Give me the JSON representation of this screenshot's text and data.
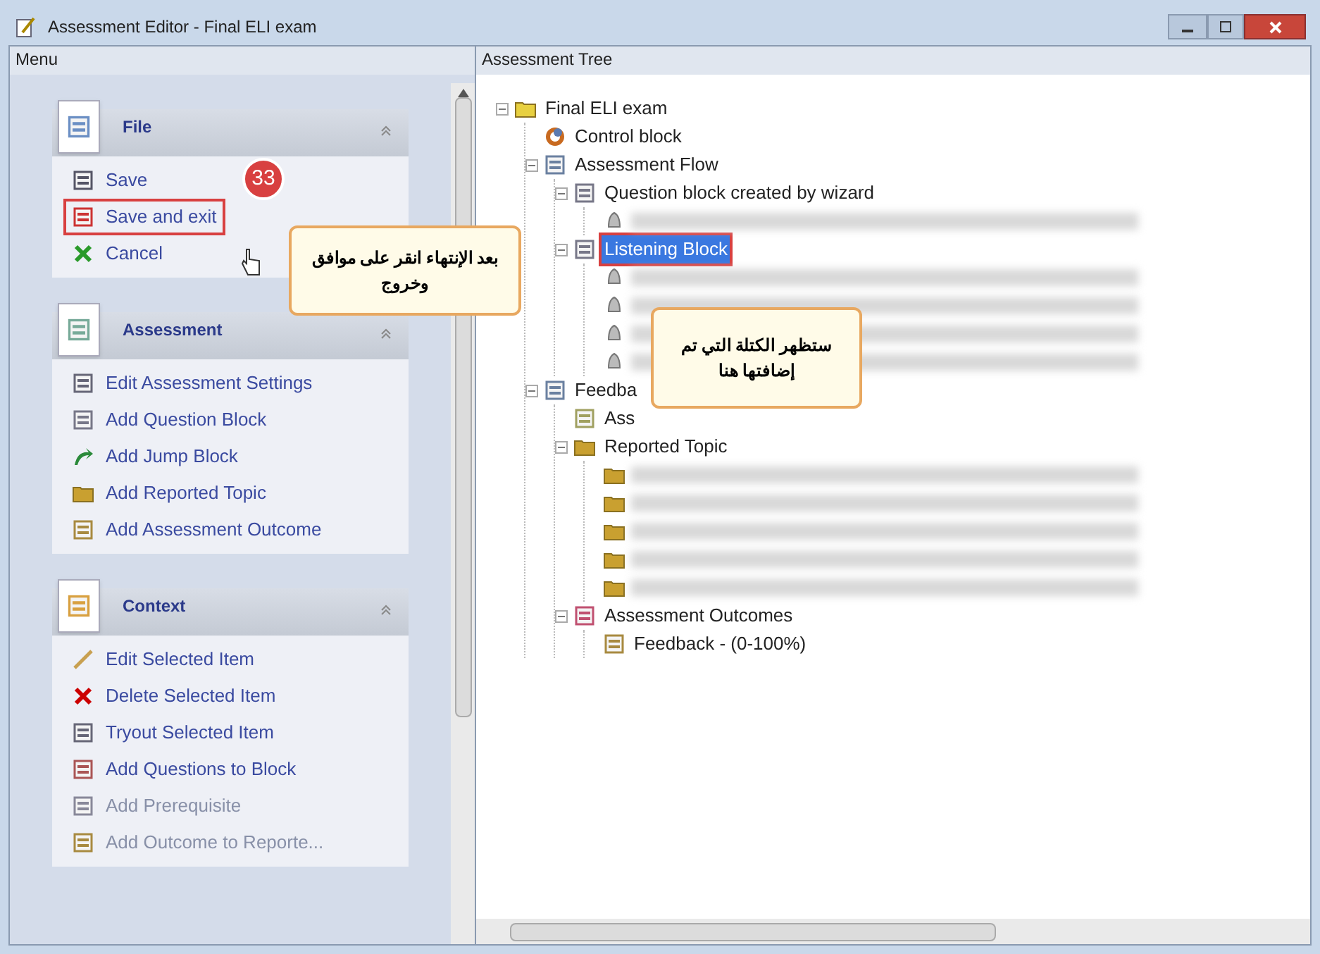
{
  "window": {
    "title": "Assessment Editor - Final ELI exam"
  },
  "menu": {
    "title": "Menu",
    "groups": [
      {
        "title": "File",
        "kind": "file",
        "expanded": true,
        "items": [
          {
            "label": "Save",
            "kind": "save",
            "disabled": false,
            "highlighted": false
          },
          {
            "label": "Save and exit",
            "kind": "save-exit",
            "disabled": false,
            "highlighted": true
          },
          {
            "label": "Cancel",
            "kind": "cancel",
            "disabled": false,
            "highlighted": false
          }
        ]
      },
      {
        "title": "Assessment",
        "kind": "assessment",
        "expanded": true,
        "items": [
          {
            "label": "Edit Assessment Settings",
            "kind": "settings",
            "disabled": false,
            "highlighted": false
          },
          {
            "label": "Add Question Block",
            "kind": "block",
            "disabled": false,
            "highlighted": false
          },
          {
            "label": "Add Jump Block",
            "kind": "jump",
            "disabled": false,
            "highlighted": false
          },
          {
            "label": "Add Reported Topic",
            "kind": "topic",
            "disabled": false,
            "highlighted": false
          },
          {
            "label": "Add Assessment Outcome",
            "kind": "outcome",
            "disabled": false,
            "highlighted": false
          }
        ]
      },
      {
        "title": "Context",
        "kind": "context",
        "expanded": true,
        "items": [
          {
            "label": "Edit Selected Item",
            "kind": "edit",
            "disabled": false,
            "highlighted": false
          },
          {
            "label": "Delete Selected Item",
            "kind": "delete",
            "disabled": false,
            "highlighted": false
          },
          {
            "label": "Tryout Selected Item",
            "kind": "tryout",
            "disabled": false,
            "highlighted": false
          },
          {
            "label": "Add Questions to Block",
            "kind": "questions",
            "disabled": false,
            "highlighted": false
          },
          {
            "label": "Add Prerequisite",
            "kind": "prereq",
            "disabled": true,
            "highlighted": false
          },
          {
            "label": "Add Outcome to Reporte...",
            "kind": "outcome",
            "disabled": true,
            "highlighted": false
          }
        ]
      }
    ]
  },
  "tree": {
    "title": "Assessment Tree",
    "nodes": [
      {
        "label": "Final ELI exam",
        "kind": "folder",
        "expanded": true,
        "selected": false,
        "children": [
          {
            "label": "Control block",
            "kind": "control",
            "selected": false
          },
          {
            "label": "Assessment Flow",
            "kind": "flow",
            "expanded": true,
            "selected": false,
            "children": [
              {
                "label": "Question block created by wizard",
                "kind": "block",
                "expanded": true,
                "selected": false,
                "children": [
                  {
                    "kind": "question",
                    "redacted": true
                  }
                ]
              },
              {
                "label": "Listening Block",
                "kind": "block",
                "expanded": true,
                "selected": true,
                "children": [
                  {
                    "kind": "question",
                    "redacted": true
                  },
                  {
                    "kind": "question",
                    "redacted": true
                  },
                  {
                    "kind": "question",
                    "redacted": true
                  },
                  {
                    "kind": "question",
                    "redacted": true
                  }
                ]
              }
            ]
          },
          {
            "label": "Feedba",
            "kind": "feedback",
            "expanded": true,
            "selected": false,
            "children": [
              {
                "label": "Ass",
                "kind": "page",
                "selected": false
              },
              {
                "label": "Reported Topic",
                "kind": "topic",
                "expanded": true,
                "selected": false,
                "children": [
                  {
                    "kind": "topic",
                    "redacted": true
                  },
                  {
                    "kind": "topic",
                    "redacted": true
                  },
                  {
                    "kind": "topic",
                    "redacted": true
                  },
                  {
                    "kind": "topic",
                    "redacted": true
                  },
                  {
                    "kind": "topic",
                    "redacted": true
                  }
                ]
              },
              {
                "label": "Assessment Outcomes",
                "kind": "outcomes",
                "expanded": true,
                "selected": false,
                "children": [
                  {
                    "label": "Feedback - (0-100%)",
                    "kind": "outcome",
                    "selected": false
                  }
                ]
              }
            ]
          }
        ]
      }
    ]
  },
  "annotations": {
    "step_badge": "33",
    "callouts": [
      {
        "text": "بعد الإنتهاء انقر على موافق وخروج"
      },
      {
        "text": "ستظهر الكتلة التي تم إضافتها هنا"
      }
    ]
  }
}
